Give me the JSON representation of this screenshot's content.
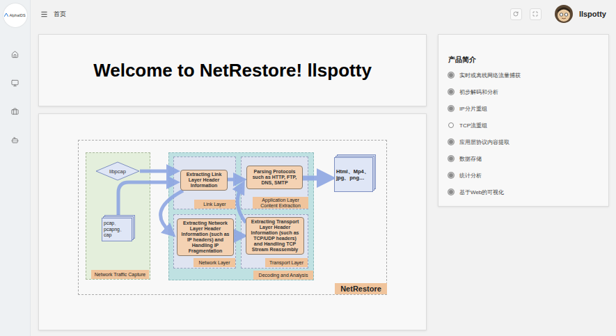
{
  "sidebar": {
    "logo": "AlphaIDS"
  },
  "header": {
    "breadcrumb": "首页",
    "user": "llspotty"
  },
  "welcome": "Welcome to NetRestore! llspotty",
  "diagram": {
    "source": "libpcap",
    "files": "pcap、pcapng、cap",
    "capture_label": "Network Traffic Capture",
    "link_node": "Extracting Link Layer Header Information",
    "link_label": "Link Layer",
    "app_node": "Parsing Protocols such as HTTP, FTP, DNS, SMTP",
    "app_label": "Application Layer Content Extraction",
    "network_node": "Extracting Network Layer Header Information (such as IP headers) and Handling IP Fragmentation",
    "network_label": "Network Layer",
    "transport_node": "Extracting Transport Layer Header Information (such as TCP/UDP headers) and Handling TCP Stream Reassembly",
    "transport_label": "Transport Layer",
    "decoding_label": "Decoding and Analysis",
    "outputs": "Html、Mp4、jpg、png…",
    "brand": "NetRestore"
  },
  "intro": {
    "title": "产品简介",
    "items": [
      {
        "label": "实时或离线网络流量捕获",
        "filled": true
      },
      {
        "label": "初步解码和分析",
        "filled": true
      },
      {
        "label": "IP分片重组",
        "filled": true
      },
      {
        "label": "TCP流重组",
        "filled": false
      },
      {
        "label": "应用层协议内容提取",
        "filled": true
      },
      {
        "label": "数据存储",
        "filled": true
      },
      {
        "label": "统计分析",
        "filled": true
      },
      {
        "label": "基于Web的可视化",
        "filled": true
      }
    ]
  }
}
